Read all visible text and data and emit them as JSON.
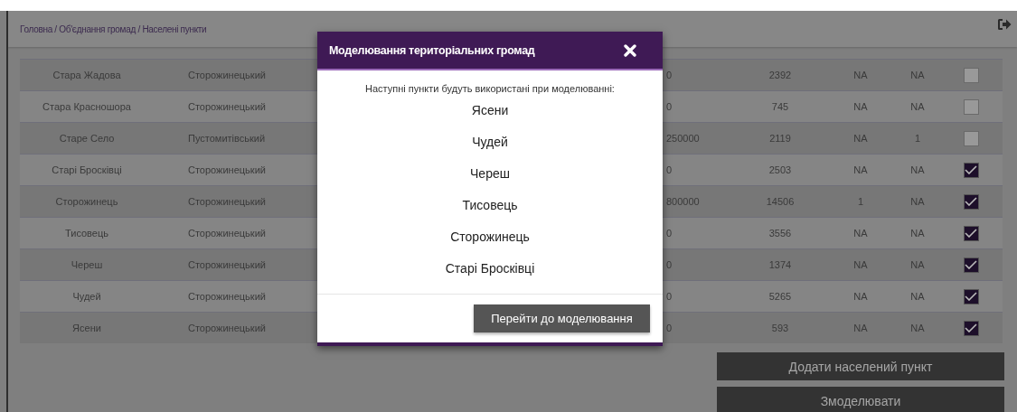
{
  "breadcrumb": "Головна / Об'єднання громад / Населені пункти",
  "table": {
    "rows": [
      {
        "name": "Стара Жадова",
        "district": "Сторожинецький",
        "column_5": "0",
        "column_6": "2392",
        "column_7": "NA",
        "column_8": "NA",
        "checked": false
      },
      {
        "name": "Стара Красношора",
        "district": "Сторожинецький",
        "column_5": "0",
        "column_6": "745",
        "column_7": "NA",
        "column_8": "NA",
        "checked": false
      },
      {
        "name": "Старе Село",
        "district": "Пустомитівський",
        "column_5": "250000",
        "column_6": "2119",
        "column_7": "NA",
        "column_8": "1",
        "checked": false
      },
      {
        "name": "Старі Бросківці",
        "district": "Сторожинецький",
        "column_5": "0",
        "column_6": "2503",
        "column_7": "NA",
        "column_8": "NA",
        "checked": true
      },
      {
        "name": "Сторожинець",
        "district": "Сторожинецький",
        "column_5": "800000",
        "column_6": "14506",
        "column_7": "1",
        "column_8": "NA",
        "checked": true
      },
      {
        "name": "Тисовець",
        "district": "Сторожинецький",
        "column_5": "0",
        "column_6": "3556",
        "column_7": "NA",
        "column_8": "NA",
        "checked": true
      },
      {
        "name": "Череш",
        "district": "Сторожинецький",
        "column_5": "0",
        "column_6": "1374",
        "column_7": "NA",
        "column_8": "NA",
        "checked": true
      },
      {
        "name": "Чудей",
        "district": "Сторожинецький",
        "column_5": "0",
        "column_6": "5265",
        "column_7": "NA",
        "column_8": "NA",
        "checked": true
      },
      {
        "name": "Ясени",
        "district": "Сторожинецький",
        "column_5": "0",
        "column_6": "593",
        "column_7": "NA",
        "column_8": "NA",
        "checked": true
      }
    ]
  },
  "buttons": [
    "Додати населений пункт",
    "Змоделювати"
  ],
  "modal": {
    "title": "Моделювання територіальних громад",
    "intro": "Наступні пункти будуть використані при моделюванні:",
    "items": [
      "Ясени",
      "Чудей",
      "Череш",
      "Тисовець",
      "Сторожинець",
      "Старі Бросківці"
    ],
    "button": "Перейти до моделювання"
  }
}
